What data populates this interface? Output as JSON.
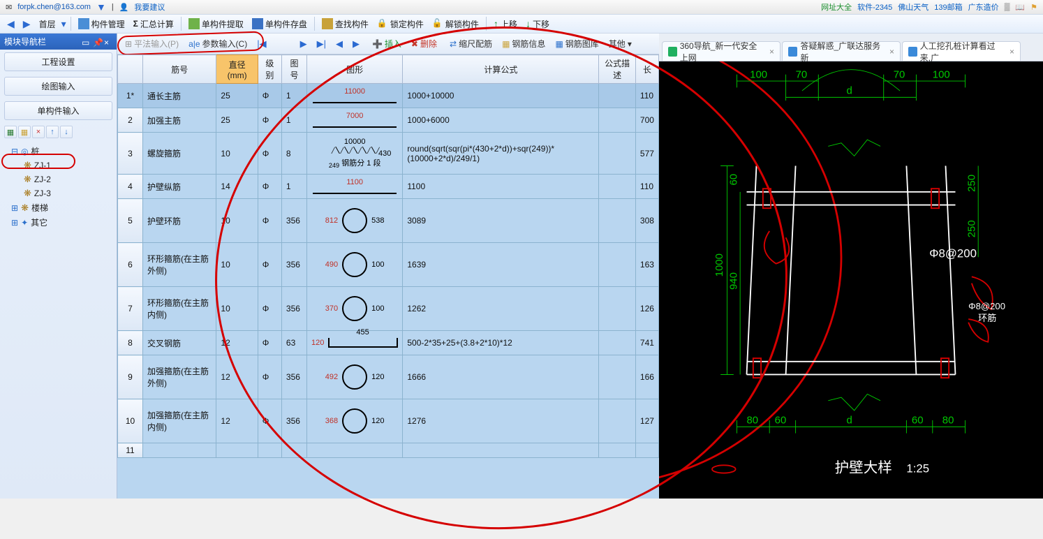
{
  "topbar": {
    "email": "forpk.chen@163.com",
    "suggest": "我要建议",
    "links": [
      "网址大全",
      "软件-2345",
      "佛山天气",
      "139邮箱",
      "广东造价"
    ]
  },
  "toolbar": {
    "items": [
      "首层",
      "构件管理",
      "汇总计算",
      "单构件提取",
      "单构件存盘",
      "查找构件",
      "锁定构件",
      "解锁构件",
      "上移",
      "下移"
    ]
  },
  "leftpanel": {
    "title": "模块导航栏",
    "buttons": [
      "工程设置",
      "绘图输入",
      "单构件输入"
    ],
    "tree": {
      "root": "桩",
      "children": [
        "ZJ-1",
        "ZJ-2",
        "ZJ-3"
      ],
      "others": [
        "楼梯",
        "其它"
      ]
    }
  },
  "subtoolbar": {
    "pf": "平法输入(P)",
    "param": "参数输入(C)",
    "ins": "插入",
    "del": "删除",
    "scale": "缩尺配筋",
    "info": "钢筋信息",
    "lib": "钢筋图库",
    "other": "其他"
  },
  "table": {
    "headers": [
      "",
      "筋号",
      "直径(mm)",
      "级别",
      "图号",
      "图形",
      "计算公式",
      "公式描述",
      "长"
    ],
    "rows": [
      {
        "n": "1*",
        "name": "通长主筋",
        "dia": "25",
        "lvl": "Φ",
        "tu": "1",
        "shape_type": "line",
        "shape_vals": [
          "11000"
        ],
        "formula": "1000+10000",
        "desc": "",
        "len": "110"
      },
      {
        "n": "2",
        "name": "加强主筋",
        "dia": "25",
        "lvl": "Φ",
        "tu": "1",
        "shape_type": "line",
        "shape_vals": [
          "7000"
        ],
        "formula": "1000+6000",
        "desc": "",
        "len": "700"
      },
      {
        "n": "3",
        "name": "螺旋箍筋",
        "dia": "10",
        "lvl": "Φ",
        "tu": "8",
        "shape_type": "zigzag",
        "shape_vals": [
          "10000",
          "430",
          "249",
          "钢筋分 1 段"
        ],
        "formula": "round(sqrt(sqr(pi*(430+2*d))+sqr(249))*(10000+2*d)/249/1)",
        "desc": "",
        "len": "577"
      },
      {
        "n": "4",
        "name": "护壁纵筋",
        "dia": "14",
        "lvl": "Φ",
        "tu": "1",
        "shape_type": "line",
        "shape_vals": [
          "1100"
        ],
        "formula": "1100",
        "desc": "",
        "len": "110"
      },
      {
        "n": "5",
        "name": "护壁环筋",
        "dia": "10",
        "lvl": "Φ",
        "tu": "356",
        "shape_type": "circle",
        "shape_vals": [
          "812",
          "538"
        ],
        "formula": "3089",
        "desc": "",
        "len": "308"
      },
      {
        "n": "6",
        "name": "环形箍筋(在主筋外侧)",
        "dia": "10",
        "lvl": "Φ",
        "tu": "356",
        "shape_type": "circle",
        "shape_vals": [
          "490",
          "100"
        ],
        "formula": "1639",
        "desc": "",
        "len": "163"
      },
      {
        "n": "7",
        "name": "环形箍筋(在主筋内侧)",
        "dia": "10",
        "lvl": "Φ",
        "tu": "356",
        "shape_type": "circle",
        "shape_vals": [
          "370",
          "100"
        ],
        "formula": "1262",
        "desc": "",
        "len": "126"
      },
      {
        "n": "8",
        "name": "交叉钢筋",
        "dia": "12",
        "lvl": "Φ",
        "tu": "63",
        "shape_type": "bracket",
        "shape_vals": [
          "120",
          "455"
        ],
        "formula": "500-2*35+25+(3.8+2*10)*12",
        "desc": "",
        "len": "741"
      },
      {
        "n": "9",
        "name": "加强箍筋(在主筋外侧)",
        "dia": "12",
        "lvl": "Φ",
        "tu": "356",
        "shape_type": "circle",
        "shape_vals": [
          "492",
          "120"
        ],
        "formula": "1666",
        "desc": "",
        "len": "166"
      },
      {
        "n": "10",
        "name": "加强箍筋(在主筋内侧)",
        "dia": "12",
        "lvl": "Φ",
        "tu": "356",
        "shape_type": "circle",
        "shape_vals": [
          "368",
          "120"
        ],
        "formula": "1276",
        "desc": "",
        "len": "127"
      },
      {
        "n": "11",
        "name": "",
        "dia": "",
        "lvl": "",
        "tu": "",
        "shape_type": "",
        "shape_vals": [],
        "formula": "",
        "desc": "",
        "len": ""
      }
    ]
  },
  "tabs": [
    {
      "label": "360导航_新一代安全上网",
      "fav": "#20b060"
    },
    {
      "label": "答疑解惑_广联达服务新",
      "fav": "#3b8ad9"
    },
    {
      "label": "人工挖孔桩计算看过来,广",
      "fav": "#3b8ad9",
      "active": true
    }
  ],
  "cad": {
    "dims": {
      "top_left": "100",
      "top_r1": "70",
      "top_r2": "70",
      "top_right": "100",
      "d": "d",
      "bot_80l": "80",
      "bot_60l": "60",
      "bot_d": "d",
      "bot_60r": "60",
      "bot_80r": "80",
      "h_1000": "1000",
      "h_940": "940",
      "h_60": "60",
      "h_250t": "250",
      "h_250b": "250"
    },
    "labels": {
      "phi1": "Φ8@200",
      "phi2": "Φ8@200",
      "huanj": "环筋",
      "title": "护壁大样",
      "scale": "1:25"
    }
  }
}
